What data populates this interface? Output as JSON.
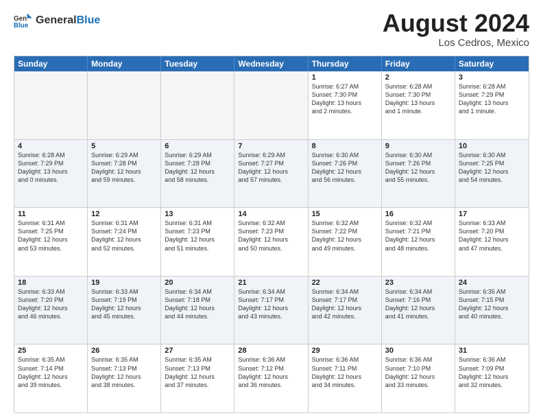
{
  "header": {
    "logo_general": "General",
    "logo_blue": "Blue",
    "month_year": "August 2024",
    "location": "Los Cedros, Mexico"
  },
  "days_of_week": [
    "Sunday",
    "Monday",
    "Tuesday",
    "Wednesday",
    "Thursday",
    "Friday",
    "Saturday"
  ],
  "rows": [
    [
      {
        "day": "",
        "info": "",
        "empty": true
      },
      {
        "day": "",
        "info": "",
        "empty": true
      },
      {
        "day": "",
        "info": "",
        "empty": true
      },
      {
        "day": "",
        "info": "",
        "empty": true
      },
      {
        "day": "1",
        "info": "Sunrise: 6:27 AM\nSunset: 7:30 PM\nDaylight: 13 hours\nand 2 minutes."
      },
      {
        "day": "2",
        "info": "Sunrise: 6:28 AM\nSunset: 7:30 PM\nDaylight: 13 hours\nand 1 minute."
      },
      {
        "day": "3",
        "info": "Sunrise: 6:28 AM\nSunset: 7:29 PM\nDaylight: 13 hours\nand 1 minute."
      }
    ],
    [
      {
        "day": "4",
        "info": "Sunrise: 6:28 AM\nSunset: 7:29 PM\nDaylight: 13 hours\nand 0 minutes."
      },
      {
        "day": "5",
        "info": "Sunrise: 6:29 AM\nSunset: 7:28 PM\nDaylight: 12 hours\nand 59 minutes."
      },
      {
        "day": "6",
        "info": "Sunrise: 6:29 AM\nSunset: 7:28 PM\nDaylight: 12 hours\nand 58 minutes."
      },
      {
        "day": "7",
        "info": "Sunrise: 6:29 AM\nSunset: 7:27 PM\nDaylight: 12 hours\nand 57 minutes."
      },
      {
        "day": "8",
        "info": "Sunrise: 6:30 AM\nSunset: 7:26 PM\nDaylight: 12 hours\nand 56 minutes."
      },
      {
        "day": "9",
        "info": "Sunrise: 6:30 AM\nSunset: 7:26 PM\nDaylight: 12 hours\nand 55 minutes."
      },
      {
        "day": "10",
        "info": "Sunrise: 6:30 AM\nSunset: 7:25 PM\nDaylight: 12 hours\nand 54 minutes."
      }
    ],
    [
      {
        "day": "11",
        "info": "Sunrise: 6:31 AM\nSunset: 7:25 PM\nDaylight: 12 hours\nand 53 minutes."
      },
      {
        "day": "12",
        "info": "Sunrise: 6:31 AM\nSunset: 7:24 PM\nDaylight: 12 hours\nand 52 minutes."
      },
      {
        "day": "13",
        "info": "Sunrise: 6:31 AM\nSunset: 7:23 PM\nDaylight: 12 hours\nand 51 minutes."
      },
      {
        "day": "14",
        "info": "Sunrise: 6:32 AM\nSunset: 7:23 PM\nDaylight: 12 hours\nand 50 minutes."
      },
      {
        "day": "15",
        "info": "Sunrise: 6:32 AM\nSunset: 7:22 PM\nDaylight: 12 hours\nand 49 minutes."
      },
      {
        "day": "16",
        "info": "Sunrise: 6:32 AM\nSunset: 7:21 PM\nDaylight: 12 hours\nand 48 minutes."
      },
      {
        "day": "17",
        "info": "Sunrise: 6:33 AM\nSunset: 7:20 PM\nDaylight: 12 hours\nand 47 minutes."
      }
    ],
    [
      {
        "day": "18",
        "info": "Sunrise: 6:33 AM\nSunset: 7:20 PM\nDaylight: 12 hours\nand 46 minutes."
      },
      {
        "day": "19",
        "info": "Sunrise: 6:33 AM\nSunset: 7:19 PM\nDaylight: 12 hours\nand 45 minutes."
      },
      {
        "day": "20",
        "info": "Sunrise: 6:34 AM\nSunset: 7:18 PM\nDaylight: 12 hours\nand 44 minutes."
      },
      {
        "day": "21",
        "info": "Sunrise: 6:34 AM\nSunset: 7:17 PM\nDaylight: 12 hours\nand 43 minutes."
      },
      {
        "day": "22",
        "info": "Sunrise: 6:34 AM\nSunset: 7:17 PM\nDaylight: 12 hours\nand 42 minutes."
      },
      {
        "day": "23",
        "info": "Sunrise: 6:34 AM\nSunset: 7:16 PM\nDaylight: 12 hours\nand 41 minutes."
      },
      {
        "day": "24",
        "info": "Sunrise: 6:35 AM\nSunset: 7:15 PM\nDaylight: 12 hours\nand 40 minutes."
      }
    ],
    [
      {
        "day": "25",
        "info": "Sunrise: 6:35 AM\nSunset: 7:14 PM\nDaylight: 12 hours\nand 39 minutes."
      },
      {
        "day": "26",
        "info": "Sunrise: 6:35 AM\nSunset: 7:13 PM\nDaylight: 12 hours\nand 38 minutes."
      },
      {
        "day": "27",
        "info": "Sunrise: 6:35 AM\nSunset: 7:13 PM\nDaylight: 12 hours\nand 37 minutes."
      },
      {
        "day": "28",
        "info": "Sunrise: 6:36 AM\nSunset: 7:12 PM\nDaylight: 12 hours\nand 36 minutes."
      },
      {
        "day": "29",
        "info": "Sunrise: 6:36 AM\nSunset: 7:11 PM\nDaylight: 12 hours\nand 34 minutes."
      },
      {
        "day": "30",
        "info": "Sunrise: 6:36 AM\nSunset: 7:10 PM\nDaylight: 12 hours\nand 33 minutes."
      },
      {
        "day": "31",
        "info": "Sunrise: 6:36 AM\nSunset: 7:09 PM\nDaylight: 12 hours\nand 32 minutes."
      }
    ]
  ]
}
